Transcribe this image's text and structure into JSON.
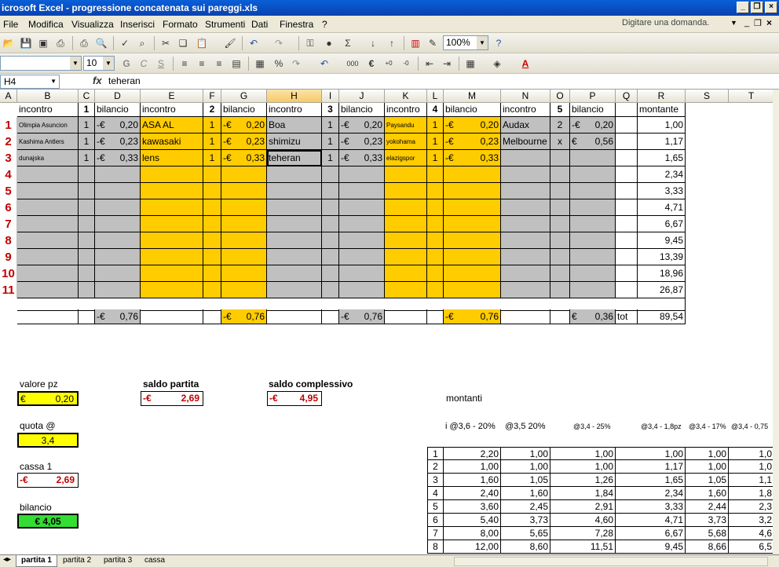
{
  "window": {
    "title": "icrosoft Excel - progressione concatenata sui pareggi.xls"
  },
  "menu": {
    "items": [
      "File",
      "Modifica",
      "Visualizza",
      "Inserisci",
      "Formato",
      "Strumenti",
      "Dati",
      "Finestra",
      "?"
    ],
    "ask": "Digitare una domanda."
  },
  "toolbar": {
    "zoom": "100%",
    "font_size": "10"
  },
  "formula": {
    "namebox": "H4",
    "value": "teheran"
  },
  "columns": [
    "A",
    "B",
    "C",
    "D",
    "E",
    "F",
    "G",
    "H",
    "I",
    "J",
    "K",
    "L",
    "M",
    "N",
    "O",
    "P",
    "Q",
    "R",
    "S",
    "T"
  ],
  "header_row": [
    "incontro",
    "1",
    "bilancio",
    "incontro",
    "2",
    "bilancio",
    "incontro",
    "3",
    "bilancio",
    "incontro",
    "4",
    "bilancio",
    "incontro",
    "5",
    "bilancio",
    "montante"
  ],
  "rows": [
    {
      "n": "1",
      "b": "Olimpia Asuncion",
      "c": "1",
      "d": "0,20",
      "e": "ASA AL",
      "f": "1",
      "g": "0,20",
      "h": "Boa",
      "i": "1",
      "j": "0,20",
      "k": "Paysandu",
      "l": "1",
      "m": "0,20",
      "n2": "Audax",
      "o": "2",
      "p": "0,20",
      "r": "1,00"
    },
    {
      "n": "2",
      "b": "Kashima Antlers",
      "c": "1",
      "d": "0,23",
      "e": "kawasaki",
      "f": "1",
      "g": "0,23",
      "h": "shimizu",
      "i": "1",
      "j": "0,23",
      "k": "yokohama",
      "l": "1",
      "m": "0,23",
      "n2": "Melbourne",
      "o": "x",
      "p": "0,56",
      "r": "1,17"
    },
    {
      "n": "3",
      "b": "dunajska",
      "c": "1",
      "d": "0,33",
      "e": "lens",
      "f": "1",
      "g": "0,33",
      "h": "teheran",
      "i": "1",
      "j": "0,33",
      "k": "elazigspor",
      "l": "1",
      "m": "0,33",
      "n2": "",
      "o": "",
      "p": "",
      "r": "1,65"
    }
  ],
  "extra_rows": [
    "4",
    "5",
    "6",
    "7",
    "8",
    "9",
    "10",
    "11"
  ],
  "montante_extra": [
    "2,34",
    "3,33",
    "4,71",
    "6,67",
    "9,45",
    "13,39",
    "18,96",
    "26,87"
  ],
  "totals": {
    "d": "0,76",
    "g": "0,76",
    "j": "0,76",
    "m": "0,76",
    "p": "0,36",
    "label": "tot",
    "r": "89,54"
  },
  "currency": "€",
  "neg_currency": "-€",
  "panel": {
    "valore_label": "valore pz",
    "valore": "0,20",
    "quota_label": "quota @",
    "quota": "3,4",
    "cassa_label": "cassa 1",
    "cassa": "2,69",
    "bilancio_label": "bilancio",
    "bilancio": "€ 4,05",
    "saldo_partita_label": "saldo partita",
    "saldo_partita": "2,69",
    "saldo_complessivo_label": "saldo complessivo",
    "saldo_complessivo": "4,95",
    "montanti_label": "montanti"
  },
  "montanti_headers": [
    "i @3,6 - 20%",
    "@3,5 20%",
    "@3,4 - 25%",
    "@3,4 - 1,8pz",
    "@3,4 - 17%",
    "@3,4 - 0,75"
  ],
  "montanti_rows": [
    [
      "1",
      "2,20",
      "1,00",
      "1,00",
      "1,00",
      "1,00",
      "1,0"
    ],
    [
      "2",
      "1,00",
      "1,00",
      "1,00",
      "1,17",
      "1,00",
      "1,0"
    ],
    [
      "3",
      "1,60",
      "1,05",
      "1,26",
      "1,65",
      "1,05",
      "1,1"
    ],
    [
      "4",
      "2,40",
      "1,60",
      "1,84",
      "2,34",
      "1,60",
      "1,8"
    ],
    [
      "5",
      "3,60",
      "2,45",
      "2,91",
      "3,33",
      "2,44",
      "2,3"
    ],
    [
      "6",
      "5,40",
      "3,73",
      "4,60",
      "4,71",
      "3,73",
      "3,2"
    ],
    [
      "7",
      "8,00",
      "5,65",
      "7,28",
      "6,67",
      "5,68",
      "4,6"
    ],
    [
      "8",
      "12,00",
      "8,60",
      "11,51",
      "9,45",
      "8,66",
      "6,5"
    ]
  ],
  "sheets": [
    "partita 1",
    "partita 2",
    "partita 3",
    "cassa"
  ]
}
